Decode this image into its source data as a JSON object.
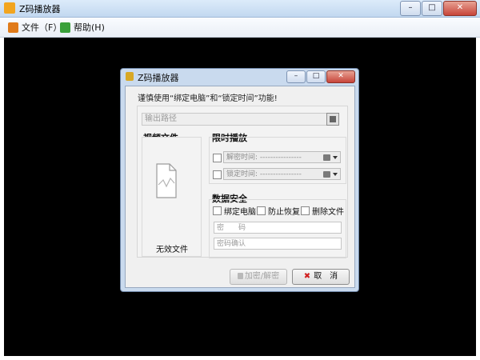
{
  "window": {
    "title": "Z码播放器",
    "minimize": "–",
    "maximize": "□",
    "close": "✕"
  },
  "menu": {
    "file": "文件（F）",
    "help": "帮助(H)"
  },
  "dialog": {
    "title": "Z码播放器",
    "hint": "谨慎使用“绑定电脑”和“锁定时间”功能!",
    "path_placeholder": "输出路径",
    "video_title": "视频文件",
    "no_file": "无效文件",
    "time_title": "限时播放",
    "unlock_time": "解密时间: ----------------",
    "lock_time": "锁定时间: ----------------",
    "security_title": "数据安全",
    "bind_pc": "绑定电脑",
    "prevent_restore": "防止恢复",
    "delete_file": "删除文件",
    "password_placeholder": "密　　码",
    "confirm_placeholder": "密码确认",
    "encrypt_button": "加密/解密",
    "cancel_button": "取　消"
  },
  "colors": {
    "workspace": "#000000",
    "dialog_frame": "#c9daee",
    "cancel_icon": "#d12020"
  }
}
